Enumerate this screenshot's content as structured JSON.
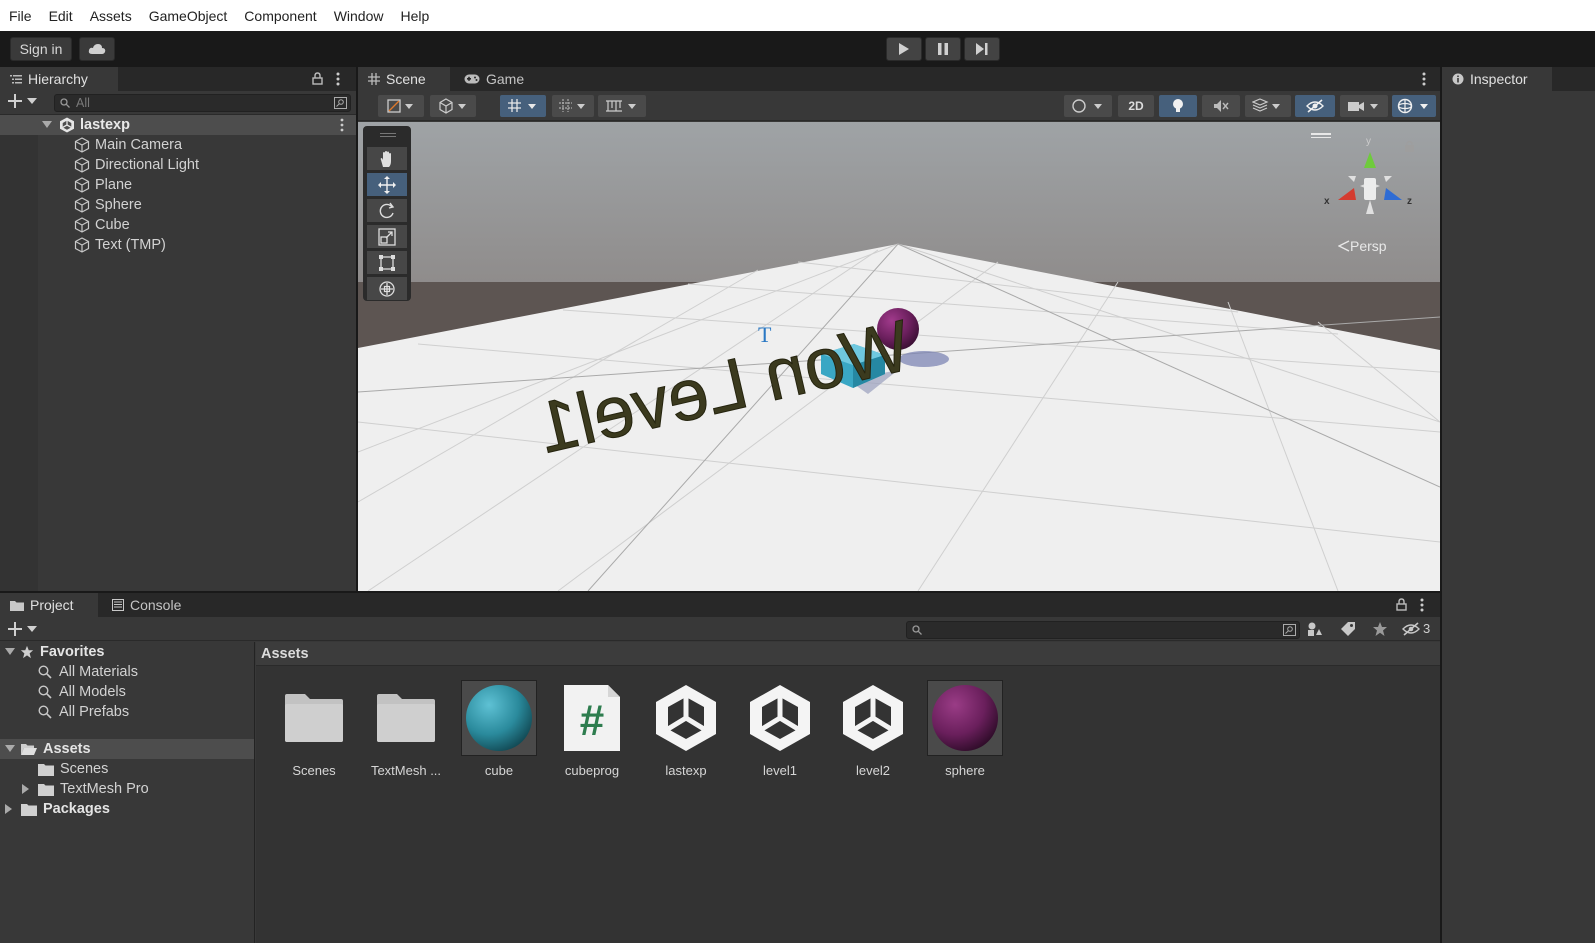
{
  "menu": [
    "File",
    "Edit",
    "Assets",
    "GameObject",
    "Component",
    "Window",
    "Help"
  ],
  "toolbar": {
    "sign_in": "Sign in"
  },
  "hierarchy": {
    "tab": "Hierarchy",
    "search_placeholder": "All",
    "scene": "lastexp",
    "items": [
      "Main Camera",
      "Directional Light",
      "Plane",
      "Sphere",
      "Cube",
      "Text (TMP)"
    ]
  },
  "scene": {
    "tabs": [
      "Scene",
      "Game"
    ],
    "btn_2d": "2D",
    "persp": "Persp",
    "gizmo": {
      "x": "x",
      "y": "y",
      "z": "z"
    },
    "world_text": "Won Level1"
  },
  "inspector": {
    "tab": "Inspector"
  },
  "project": {
    "tabs": [
      "Project",
      "Console"
    ],
    "hidden_count": "3",
    "favorites": {
      "label": "Favorites",
      "items": [
        "All Materials",
        "All Models",
        "All Prefabs"
      ]
    },
    "assets": {
      "label": "Assets",
      "children": [
        "Scenes",
        "TextMesh Pro"
      ]
    },
    "packages": "Packages",
    "breadcrumb": "Assets",
    "grid": [
      {
        "name": "Scenes",
        "type": "folder"
      },
      {
        "name": "TextMesh ...",
        "type": "folder"
      },
      {
        "name": "cube",
        "type": "material",
        "color": "#2a8a9c"
      },
      {
        "name": "cubeprog",
        "type": "script"
      },
      {
        "name": "lastexp",
        "type": "unity"
      },
      {
        "name": "level1",
        "type": "unity"
      },
      {
        "name": "level2",
        "type": "unity"
      },
      {
        "name": "sphere",
        "type": "material",
        "color": "#6a1f5c"
      }
    ]
  },
  "colors": {
    "accent": "#46607c",
    "cube": "#3aa7c4",
    "sphere": "#6a1f5c",
    "world_text": "#3b3a1e"
  }
}
